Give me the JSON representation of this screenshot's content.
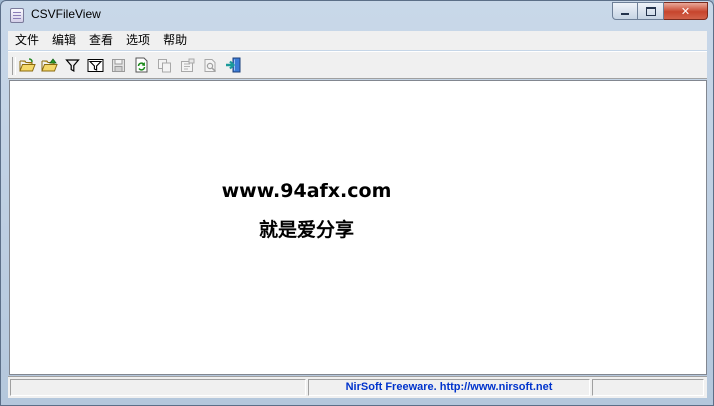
{
  "window": {
    "title": "CSVFileView",
    "controls": {
      "minimize": "minimize",
      "maximize": "maximize",
      "close": "✕"
    }
  },
  "menu": {
    "items": [
      {
        "label": "文件"
      },
      {
        "label": "编辑"
      },
      {
        "label": "查看"
      },
      {
        "label": "选项"
      },
      {
        "label": "帮助"
      }
    ]
  },
  "toolbar": {
    "buttons": [
      {
        "icon": "open-folder-icon",
        "enabled": true
      },
      {
        "icon": "open-folder-alt-icon",
        "enabled": true
      },
      {
        "icon": "filter-icon",
        "enabled": true
      },
      {
        "icon": "advanced-filter-icon",
        "enabled": true
      },
      {
        "icon": "save-icon",
        "enabled": false
      },
      {
        "icon": "refresh-icon",
        "enabled": true
      },
      {
        "icon": "copy-icon",
        "enabled": false
      },
      {
        "icon": "properties-icon",
        "enabled": false
      },
      {
        "icon": "find-icon",
        "enabled": false
      },
      {
        "icon": "exit-icon",
        "enabled": true
      }
    ]
  },
  "content": {
    "watermark_line1": "www.94afx.com",
    "watermark_line2": "就是爱分享"
  },
  "statusbar": {
    "panel1": "",
    "panel2": "NirSoft Freeware.  http://www.nirsoft.net",
    "panel3": ""
  },
  "colors": {
    "link": "#0033cc",
    "close_button": "#c7452d",
    "frame": "#b4c7dc"
  }
}
